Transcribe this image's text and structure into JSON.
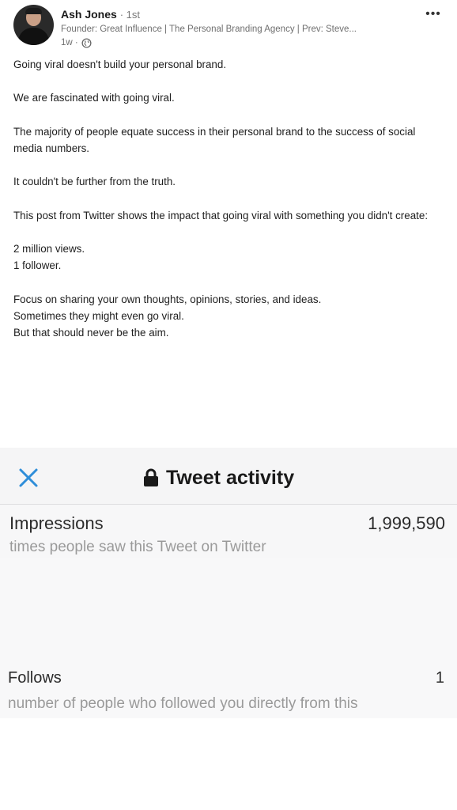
{
  "post": {
    "author": "Ash Jones",
    "connection": "· 1st",
    "headline": "Founder: Great Influence | The Personal Branding Agency | Prev: Steve...",
    "time": "1w ·",
    "more_label": "•••",
    "paragraphs": [
      "Going viral doesn't build your personal brand.",
      "",
      "We are fascinated with going viral.",
      "",
      "The majority of people equate success in their personal brand to the success of social media numbers.",
      "",
      "It couldn't be further from the truth.",
      "",
      "This post from Twitter shows the impact that going viral with something you didn't create:",
      "",
      "2 million views.",
      "1 follower.",
      "",
      "Focus on sharing your own thoughts, opinions, stories, and ideas.",
      "Sometimes they might even go viral.",
      "But that should never be the aim."
    ]
  },
  "tweet_activity": {
    "title": "Tweet activity",
    "impressions": {
      "label": "Impressions",
      "value": "1,999,590",
      "description": "times people saw this Tweet on Twitter"
    },
    "follows": {
      "label": "Follows",
      "value": "1",
      "description": "number of people who followed you directly from this"
    }
  },
  "colors": {
    "accent_blue": "#2f8ed9",
    "muted_text": "#9a9a9a"
  },
  "icons": [
    "avatar",
    "globe-icon",
    "more-icon",
    "close-icon",
    "lock-icon"
  ]
}
